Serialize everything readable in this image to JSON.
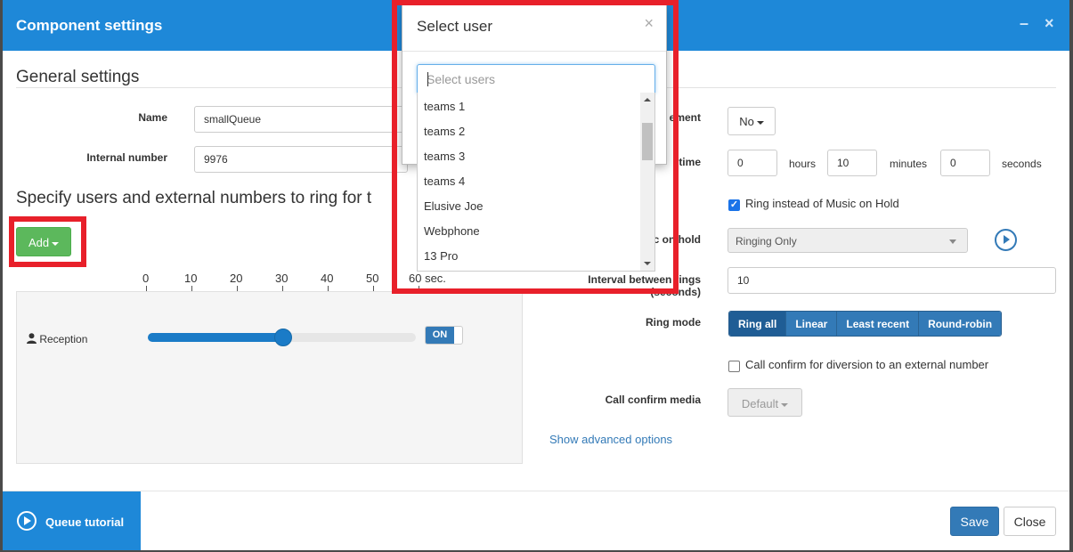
{
  "window": {
    "title": "Component settings",
    "minimize_glyph": "–",
    "close_glyph": "×"
  },
  "general": {
    "title": "General settings",
    "name_label": "Name",
    "name_value": "smallQueue",
    "internal_label": "Internal number",
    "internal_value": "9976"
  },
  "right": {
    "announcement_label_fragment": "ement",
    "announcement_value": "No",
    "time_label_fragment": "time",
    "hours_value": "0",
    "hours_label": "hours",
    "minutes_value": "10",
    "minutes_label": "minutes",
    "seconds_value": "0",
    "seconds_label": "seconds",
    "ring_instead_label": "Ring instead of Music on Hold",
    "ring_instead_checked": true,
    "moh_label_fragment": "c on hold",
    "moh_value": "Ringing Only",
    "interval_label_fragment": "Interval between rings",
    "interval_label_line2": "(seconds)",
    "interval_value": "10",
    "ring_mode_label": "Ring mode",
    "ring_modes": [
      "Ring all",
      "Linear",
      "Least recent",
      "Round-robin"
    ],
    "call_confirm_label": "Call confirm for diversion to an external number",
    "call_confirm_checked": false,
    "confirm_media_label": "Call confirm media",
    "confirm_media_value": "Default",
    "advanced_link": "Show advanced options"
  },
  "specify": {
    "title": "Specify users and external numbers to ring for t",
    "add_label": "Add",
    "scale": [
      "0",
      "10",
      "20",
      "30",
      "40",
      "50",
      "60 sec."
    ],
    "member": {
      "name": "Reception",
      "ring_seconds": 30,
      "toggle": "ON"
    }
  },
  "footer": {
    "tutorial_label": "Queue tutorial",
    "save_label": "Save",
    "close_label": "Close"
  },
  "modal": {
    "title": "Select user",
    "close_glyph": "×",
    "search_placeholder": "Select users",
    "options": [
      "teams 1",
      "teams 2",
      "teams 3",
      "teams 4",
      "Elusive Joe",
      "Webphone",
      "13 Pro"
    ]
  },
  "colors": {
    "titlebar": "#1e88d8",
    "highlight": "#e8202a",
    "primary": "#337ab7",
    "success": "#5cb85c"
  }
}
